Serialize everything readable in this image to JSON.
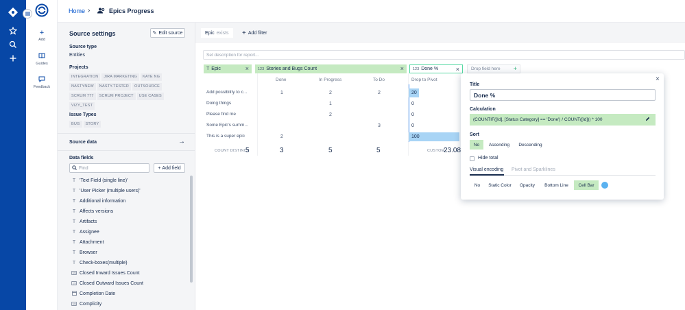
{
  "rail": {
    "icons": [
      "logo-icon",
      "menu-icon",
      "star-icon",
      "search-icon",
      "plus-icon"
    ]
  },
  "nav": {
    "add_label": "Add",
    "guides_label": "Guides",
    "feedback_label": "Feedback"
  },
  "header": {
    "home": "Home",
    "separator": "›",
    "title": "Epics Progress"
  },
  "source": {
    "title": "Source settings",
    "edit_label": "Edit source",
    "type_heading": "Source type",
    "type_value": "Entities",
    "projects_heading": "Projects",
    "projects": [
      "INTEGRATION",
      "JIRA MARKETING",
      "KATE NG",
      "NASTYNEW",
      "NASTY.TESTER",
      "OUTSOURCE",
      "SCRUM 777",
      "SCRUM PROJECT",
      "USE CASES",
      "VIZY_TEST"
    ],
    "issue_types_heading": "Issue Types",
    "issue_types": [
      "BUG",
      "STORY"
    ],
    "data_heading": "Source data",
    "data_arrow": "→"
  },
  "data_fields": {
    "heading": "Data fields",
    "find_placeholder": "Find",
    "add_label": "Add field",
    "items": [
      {
        "icon": "T",
        "label": "'Text Field (single line)'"
      },
      {
        "icon": "T",
        "label": "'User Picker (multiple users)'"
      },
      {
        "icon": "T",
        "label": "Additional information"
      },
      {
        "icon": "T",
        "label": "Affects versions"
      },
      {
        "icon": "T",
        "label": "Artifacts"
      },
      {
        "icon": "T",
        "label": "Assignee"
      },
      {
        "icon": "T",
        "label": "Attachment"
      },
      {
        "icon": "T",
        "label": "Browser"
      },
      {
        "icon": "T",
        "label": "Check-boxes(multiple)"
      },
      {
        "icon": "123",
        "label": "Closed Inward Issues Count"
      },
      {
        "icon": "123",
        "label": "Closed Outward Issues Count"
      },
      {
        "icon": "date",
        "label": "Completion Date"
      },
      {
        "icon": "123",
        "label": "Complicity"
      }
    ]
  },
  "filters": {
    "epic": "Epic",
    "epic_op": "exists",
    "add_label": "Add filter"
  },
  "description_placeholder": "Set description for report...",
  "columns": {
    "epic": "Epic",
    "stories": "Stories and Bugs Count",
    "done_pct": "Done %",
    "drop_here": "Drop field here"
  },
  "pivot": {
    "headers": [
      "Done",
      "In Progress",
      "To Do",
      "Drop to Pivot"
    ],
    "rows": [
      {
        "label": "Add possibility to c...",
        "done": "1",
        "in_progress": "2",
        "todo": "2",
        "pct": 20
      },
      {
        "label": "Doing things",
        "done": "",
        "in_progress": "1",
        "todo": "",
        "pct": 0
      },
      {
        "label": "Please find me",
        "done": "",
        "in_progress": "2",
        "todo": "",
        "pct": 0
      },
      {
        "label": "Some Epic's summ...",
        "done": "",
        "in_progress": "",
        "todo": "3",
        "pct": 0
      },
      {
        "label": "This is a super epic",
        "done": "2",
        "in_progress": "",
        "todo": "",
        "pct": 100
      }
    ],
    "totals": {
      "count_label": "COUNT DISTINCT",
      "count_value": "5",
      "done": "3",
      "in_progress": "5",
      "todo": "5",
      "custom_label": "CUSTOM",
      "custom_value": "23.08"
    }
  },
  "popover": {
    "title_label": "Title",
    "title_value": "Done %",
    "calc_label": "Calculation",
    "calc_value": "(COUNTIF([Id], [Status Category] == 'Done') / COUNT([Id])) * 100",
    "sort_label": "Sort",
    "sort_options": [
      "No",
      "Ascending",
      "Descending"
    ],
    "sort_selected": "No",
    "hide_total": "Hide total",
    "tabs": [
      "Visual encoding",
      "Pivot and Sparklines"
    ],
    "encodings": [
      "No",
      "Static Color",
      "Opacity",
      "Bottom Line",
      "Cell Bar"
    ],
    "encoding_selected": "Cell Bar",
    "bar_color": "#5bb2f0"
  },
  "colors": {
    "rail": "#0747a6",
    "chip": "#c5eac1",
    "bar": "#a8d4f5"
  }
}
